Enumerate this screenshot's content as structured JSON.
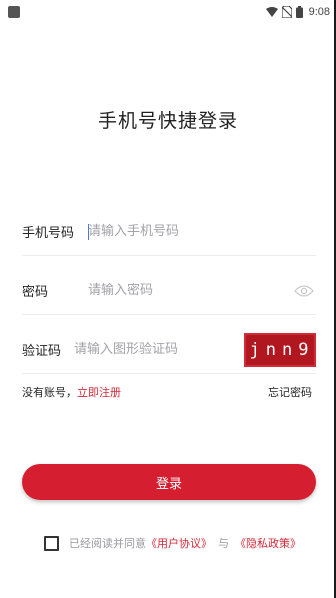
{
  "status_bar": {
    "time": "9:08",
    "icons": [
      "app-notification-icon",
      "wifi-icon",
      "no-sim-icon",
      "battery-icon"
    ]
  },
  "page": {
    "title": "手机号快捷登录"
  },
  "form": {
    "phone": {
      "label": "手机号码",
      "placeholder": "请输入手机号码",
      "value": ""
    },
    "password": {
      "label": "密码",
      "placeholder": "请输入密码",
      "value": "",
      "toggle_icon": "eye-icon"
    },
    "captcha": {
      "label": "验证码",
      "placeholder": "请输入图形验证码",
      "value": "",
      "image_text": "jnn9"
    }
  },
  "links": {
    "no_account": "没有账号，",
    "register": "立即注册",
    "forgot_password": "忘记密码"
  },
  "login_button": {
    "label": "登录"
  },
  "agreement": {
    "prefix": "已经阅读并同意",
    "user_agreement": "《用户协议》",
    "and": "与",
    "privacy_policy": "《隐私政策》",
    "checked": false
  },
  "colors": {
    "accent": "#d51f30",
    "link": "#d12a38",
    "placeholder": "#a2a2a8",
    "captcha_bg": "#b1171f"
  }
}
